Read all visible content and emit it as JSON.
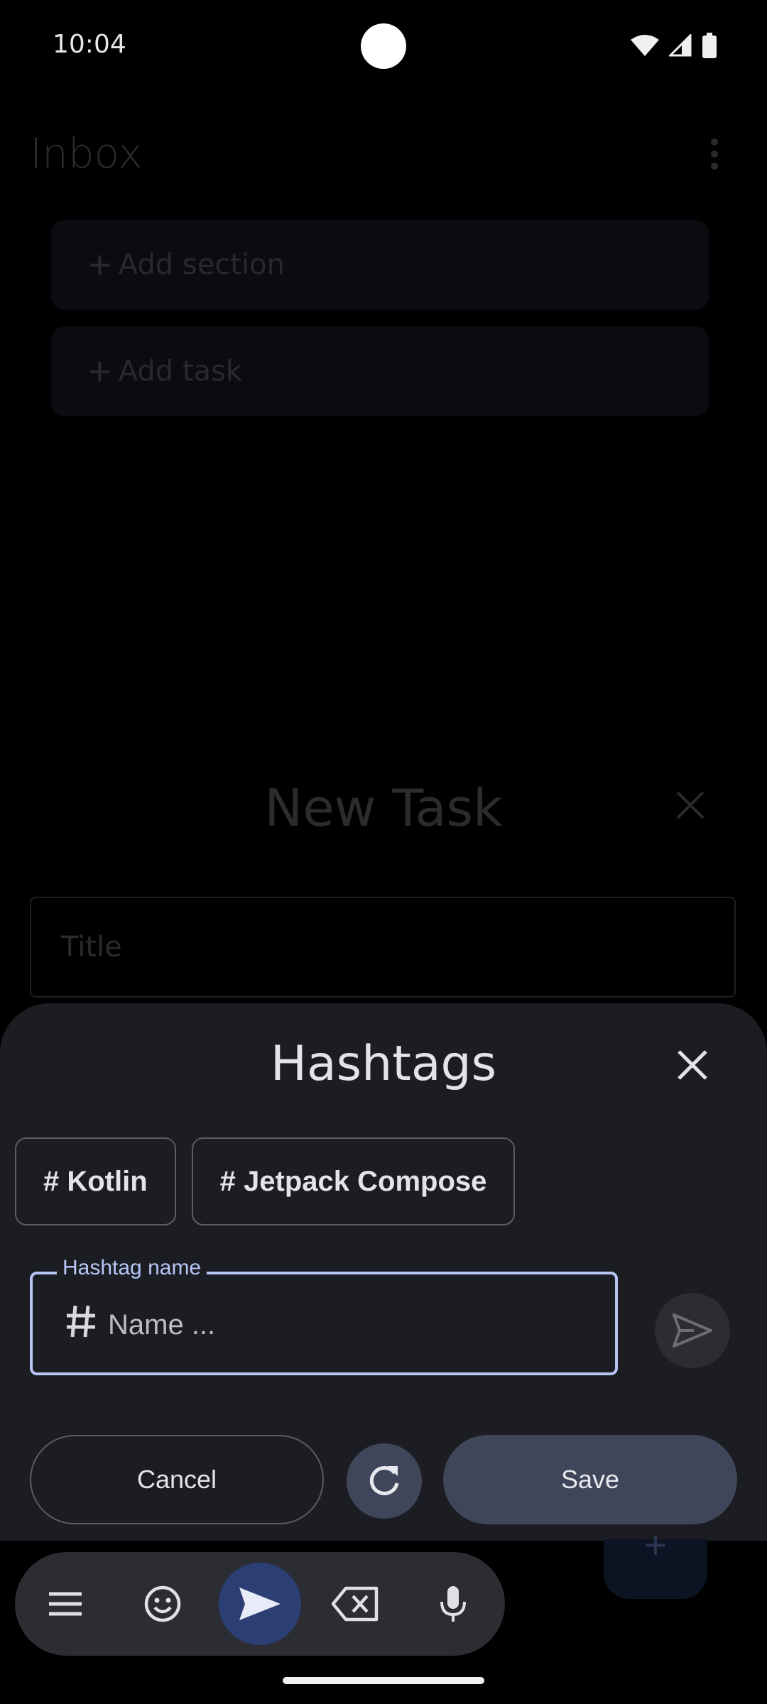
{
  "status_bar": {
    "time": "10:04"
  },
  "background": {
    "title": "Inbox",
    "cards": [
      {
        "label": "Add section"
      },
      {
        "label": "Add task"
      }
    ],
    "new_task": {
      "title": "New Task",
      "title_placeholder": "Title"
    }
  },
  "sheet": {
    "title": "Hashtags",
    "chips": [
      {
        "label": "# Kotlin"
      },
      {
        "label": "# Jetpack Compose"
      }
    ],
    "field": {
      "label": "Hashtag name",
      "placeholder": "Name ..."
    },
    "cancel_label": "Cancel",
    "save_label": "Save"
  },
  "icons": [
    "wifi-icon",
    "signal-icon",
    "battery-icon",
    "more-vert-icon",
    "close-icon",
    "hashtag-icon",
    "send-icon",
    "refresh-icon",
    "menu-icon",
    "emoji-icon",
    "backspace-icon",
    "mic-icon"
  ],
  "colors": {
    "accent": "#b5c6f4",
    "sheet_bg": "#1c1d23",
    "button_tonal": "#40465a",
    "send_primary": "#2b3f74"
  }
}
